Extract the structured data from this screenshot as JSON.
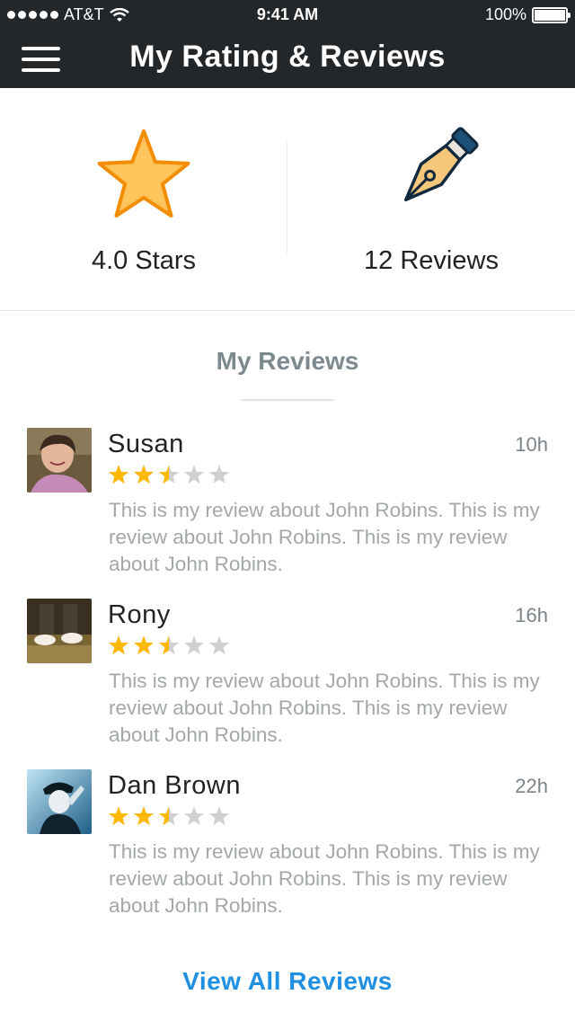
{
  "status_bar": {
    "carrier": "AT&T",
    "time": "9:41 AM",
    "battery": "100%",
    "battery_level": 1.0
  },
  "header": {
    "title": "My Rating & Reviews",
    "menu_icon": "hamburger-menu-icon"
  },
  "summary": {
    "rating_label": "4.0 Stars",
    "rating_icon": "star-icon",
    "reviews_label": "12 Reviews",
    "reviews_icon": "fountain-pen-icon"
  },
  "colors": {
    "header_bg": "#23272a",
    "star_fill": "#ffc45c",
    "star_stroke": "#f28c00",
    "rating_star": "#ffb800",
    "empty_star": "#d0d0d0",
    "link": "#1e8fe1"
  },
  "section": {
    "title": "My Reviews"
  },
  "reviews": [
    {
      "name": "Susan",
      "time": "10h",
      "rating": 2.5,
      "text": "This is my review about John Robins. This is my review about John Robins. This is my review about John Robins."
    },
    {
      "name": "Rony",
      "time": "16h",
      "rating": 2.5,
      "text": "This is my review about John Robins. This is my review about John Robins. This is my review about John Robins."
    },
    {
      "name": "Dan Brown",
      "time": "22h",
      "rating": 2.5,
      "text": "This is my review about John Robins. This is my review about John Robins. This is my review about John Robins."
    }
  ],
  "footer": {
    "view_all_label": "View All Reviews"
  }
}
